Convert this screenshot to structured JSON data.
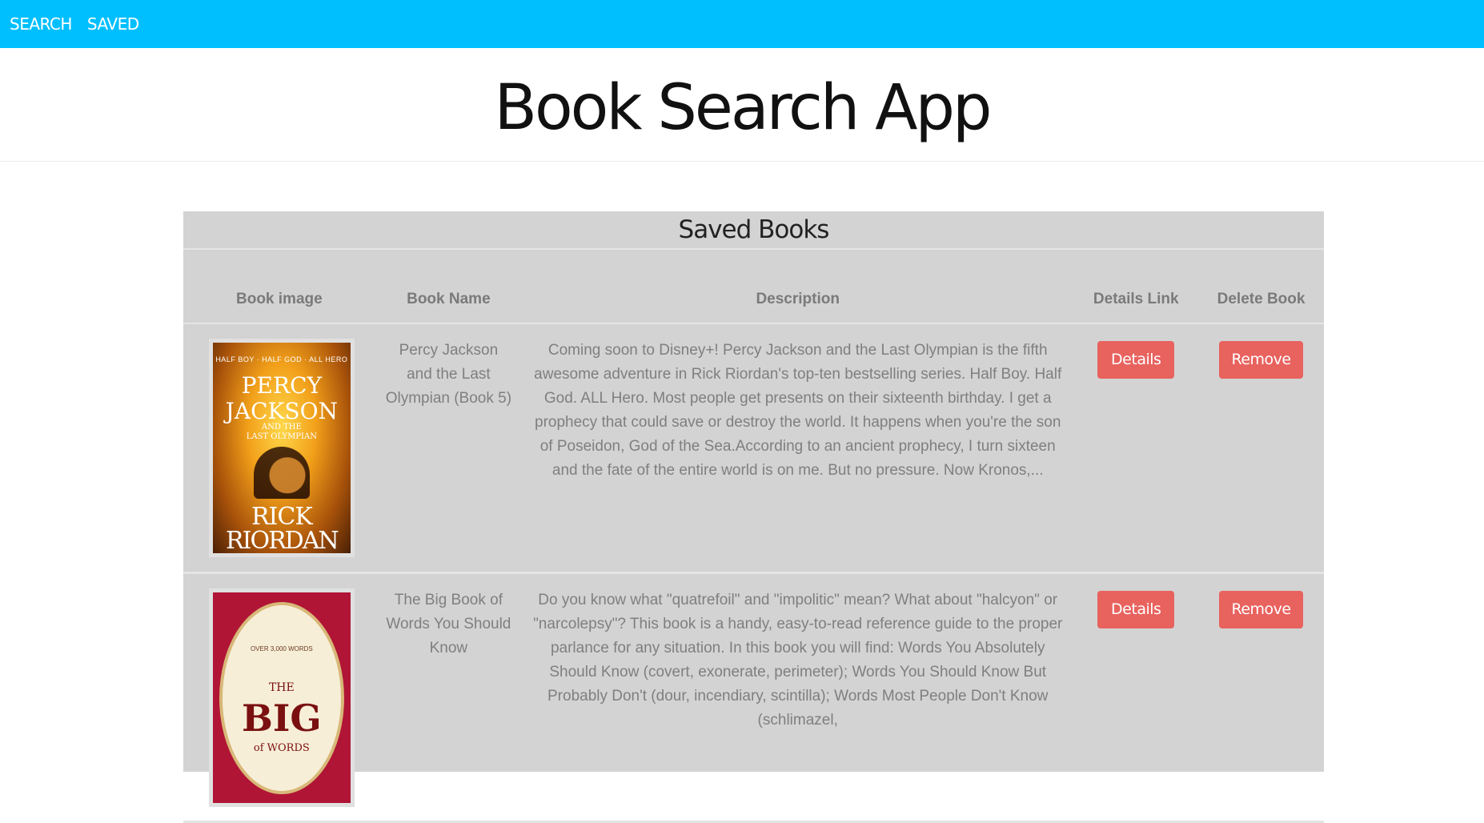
{
  "nav": {
    "search_label": "SEARCH",
    "saved_label": "SAVED"
  },
  "header": {
    "title": "Book Search App"
  },
  "saved": {
    "title": "Saved Books",
    "columns": [
      "Book image",
      "Book Name",
      "Description",
      "Details Link",
      "Delete Book"
    ],
    "books": [
      {
        "name": "Percy Jackson and the Last Olympian (Book 5)",
        "description": "Coming soon to Disney+! Percy Jackson and the Last Olympian is the fifth awesome adventure in Rick Riordan's top-ten bestselling series. Half Boy. Half God. ALL Hero. Most people get presents on their sixteenth birthday. I get a prophecy that could save or destroy the world. It happens when you're the son of Poseidon, God of the Sea.According to an ancient prophecy, I turn sixteen and the fate of the entire world is on me. But no pressure. Now Kronos,...",
        "details_label": "Details",
        "remove_label": "Remove",
        "cover": {
          "tag": "HALF BOY · HALF GOD · ALL HERO",
          "title_line1": "PERCY",
          "title_line2": "JACKSON",
          "title_line3": "AND THE",
          "title_line4": "LAST OLYMPIAN",
          "author_line1": "RICK",
          "author_line2": "RIORDAN"
        }
      },
      {
        "name": "The Big Book of Words You Should Know",
        "description": "Do you know what \"quatrefoil\" and \"impolitic\" mean? What about \"halcyon\" or \"narcolepsy\"? This book is a handy, easy-to-read reference guide to the proper parlance for any situation. In this book you will find: Words You Absolutely Should Know (covert, exonerate, perimeter); Words You Should Know But Probably Don't (dour, incendiary, scintilla); Words Most People Don't Know (schlimazel,",
        "details_label": "Details",
        "remove_label": "Remove",
        "cover": {
          "small_text": "OVER 3,000 WORDS",
          "the": "THE",
          "big": "BIG",
          "words": "of WORDS"
        }
      }
    ]
  }
}
